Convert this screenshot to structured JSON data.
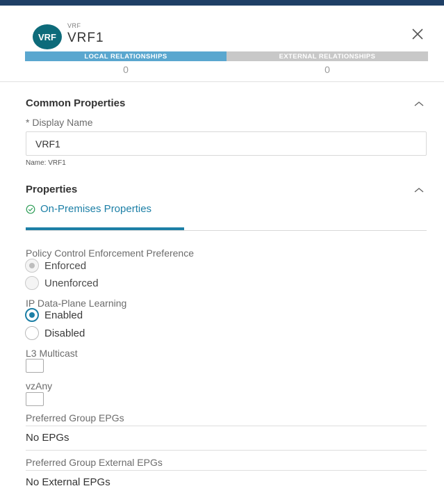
{
  "header": {
    "avatar_text": "VRF",
    "kicker": "VRF",
    "title": "VRF1",
    "close_icon": "close-icon"
  },
  "relationships": {
    "tabs": [
      {
        "label": "LOCAL RELATIONSHIPS",
        "count": "0"
      },
      {
        "label": "EXTERNAL RELATIONSHIPS",
        "count": "0"
      }
    ]
  },
  "common_properties": {
    "title": "Common Properties",
    "display_name_label": "* Display Name",
    "display_name_value": "VRF1",
    "name_help": "Name: VRF1"
  },
  "properties": {
    "title": "Properties",
    "subtab_label": "On-Premises Properties",
    "policy_control": {
      "label": "Policy Control Enforcement Preference",
      "options": [
        "Enforced",
        "Unenforced"
      ],
      "selected": "Enforced"
    },
    "ip_learning": {
      "label": "IP Data-Plane Learning",
      "options": [
        "Enabled",
        "Disabled"
      ],
      "selected": "Enabled"
    },
    "l3_multicast": {
      "label": "L3 Multicast",
      "checked": false
    },
    "vzany": {
      "label": "vzAny",
      "checked": false
    },
    "preferred_group_epgs": {
      "label": "Preferred Group EPGs",
      "value": "No EPGs"
    },
    "preferred_group_external_epgs": {
      "label": "Preferred Group External EPGs",
      "value": "No External EPGs"
    }
  },
  "colors": {
    "accent": "#1c7fa6",
    "local_tab": "#5aa7cf",
    "external_tab": "#c8c8c8",
    "avatar": "#0d6b7a"
  }
}
